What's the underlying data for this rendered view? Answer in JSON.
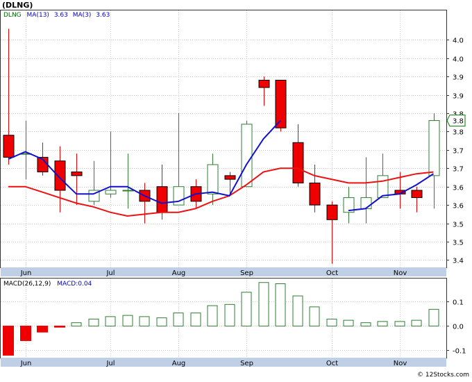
{
  "title": "(DLNG)",
  "footer": "© 12Stocks.com",
  "colors": {
    "up": "#2e7d32",
    "down": "#ee0000",
    "ma13": "#ee1111",
    "ma3": "#1111cc",
    "legend_ticker": "#006400",
    "legend_ma": "#0000cc",
    "macd": "#2e7d32",
    "last_price_box": "#007700"
  },
  "legend_top": {
    "ticker": "DLNG",
    "ma13": "MA(13)",
    "ma13_value": "3.63",
    "ma3": "MA(3)",
    "ma3_value": "3.63"
  },
  "legend_bottom": {
    "macd_params": "MACD(26,12,9)",
    "macd_value": "MACD:0.04"
  },
  "last_price_label": "3.8",
  "months": [
    {
      "label": "Jun",
      "week": 1
    },
    {
      "label": "Jul",
      "week": 6
    },
    {
      "label": "Aug",
      "week": 10
    },
    {
      "label": "Sep",
      "week": 14
    },
    {
      "label": "Oct",
      "week": 19
    },
    {
      "label": "Nov",
      "week": 23
    }
  ],
  "chart_data": [
    {
      "type": "candlestick",
      "ylim": [
        3.38,
        4.08
      ],
      "yticks": [
        3.4,
        3.45,
        3.5,
        3.55,
        3.6,
        3.65,
        3.7,
        3.75,
        3.8,
        3.85,
        3.9,
        3.95,
        4.0
      ],
      "ytick_labels": [
        "3.4",
        "3.5",
        "3.5",
        "3.6",
        "3.6",
        "3.7",
        "3.7",
        "3.8",
        "3.8",
        "3.9",
        "3.9",
        "4.0",
        "4.0"
      ],
      "grid": true,
      "candles": [
        {
          "o": 3.74,
          "h": 4.03,
          "l": 3.66,
          "c": 3.68
        },
        {
          "o": 3.69,
          "h": 3.78,
          "l": 3.62,
          "c": 3.69
        },
        {
          "o": 3.68,
          "h": 3.72,
          "l": 3.63,
          "c": 3.64
        },
        {
          "o": 3.67,
          "h": 3.71,
          "l": 3.53,
          "c": 3.59
        },
        {
          "o": 3.64,
          "h": 3.69,
          "l": 3.55,
          "c": 3.63
        },
        {
          "o": 3.56,
          "h": 3.67,
          "l": 3.55,
          "c": 3.59
        },
        {
          "o": 3.58,
          "h": 3.75,
          "l": 3.57,
          "c": 3.59
        },
        {
          "o": 3.59,
          "h": 3.69,
          "l": 3.54,
          "c": 3.59
        },
        {
          "o": 3.59,
          "h": 3.61,
          "l": 3.5,
          "c": 3.56
        },
        {
          "o": 3.6,
          "h": 3.66,
          "l": 3.51,
          "c": 3.53
        },
        {
          "o": 3.55,
          "h": 3.8,
          "l": 3.55,
          "c": 3.6
        },
        {
          "o": 3.6,
          "h": 3.62,
          "l": 3.54,
          "c": 3.56
        },
        {
          "o": 3.58,
          "h": 3.69,
          "l": 3.55,
          "c": 3.66
        },
        {
          "o": 3.63,
          "h": 3.64,
          "l": 3.58,
          "c": 3.62
        },
        {
          "o": 3.6,
          "h": 3.78,
          "l": 3.6,
          "c": 3.77
        },
        {
          "o": 3.89,
          "h": 3.9,
          "l": 3.82,
          "c": 3.87
        },
        {
          "o": 3.89,
          "h": 3.89,
          "l": 3.75,
          "c": 3.76
        },
        {
          "o": 3.72,
          "h": 3.77,
          "l": 3.6,
          "c": 3.61
        },
        {
          "o": 3.61,
          "h": 3.66,
          "l": 3.53,
          "c": 3.55
        },
        {
          "o": 3.55,
          "h": 3.56,
          "l": 3.39,
          "c": 3.51
        },
        {
          "o": 3.53,
          "h": 3.6,
          "l": 3.5,
          "c": 3.57
        },
        {
          "o": 3.54,
          "h": 3.68,
          "l": 3.5,
          "c": 3.57
        },
        {
          "o": 3.57,
          "h": 3.69,
          "l": 3.57,
          "c": 3.63
        },
        {
          "o": 3.59,
          "h": 3.64,
          "l": 3.54,
          "c": 3.58
        },
        {
          "o": 3.59,
          "h": 3.6,
          "l": 3.53,
          "c": 3.57
        },
        {
          "o": 3.63,
          "h": 3.8,
          "l": 3.54,
          "c": 3.78
        }
      ],
      "series": [
        {
          "name": "MA(13)",
          "values": [
            3.6,
            3.6,
            3.585,
            3.57,
            3.555,
            3.545,
            3.53,
            3.52,
            3.525,
            3.53,
            3.53,
            3.54,
            3.56,
            3.575,
            3.605,
            3.64,
            3.65,
            3.65,
            3.63,
            3.62,
            3.61,
            3.61,
            3.615,
            3.625,
            3.635,
            3.64
          ]
        },
        {
          "name": "MA(3)",
          "values": [
            3.675,
            3.695,
            3.675,
            3.625,
            3.58,
            3.58,
            3.6,
            3.6,
            3.575,
            3.555,
            3.56,
            3.58,
            3.585,
            3.575,
            3.66,
            3.73,
            3.78,
            null,
            null,
            null,
            3.535,
            3.54,
            3.575,
            3.58,
            3.605,
            3.635
          ]
        }
      ]
    },
    {
      "type": "bar",
      "name": "MACD(26,12,9)",
      "ylim": [
        -0.13,
        0.195
      ],
      "yticks": [
        -0.1,
        0.0,
        0.1
      ],
      "ytick_labels": [
        "-0.1",
        "0.0",
        "0.1"
      ],
      "grid": true,
      "values": [
        -0.12,
        -0.06,
        -0.025,
        -0.005,
        0.015,
        0.03,
        0.04,
        0.045,
        0.04,
        0.035,
        0.055,
        0.055,
        0.085,
        0.09,
        0.14,
        0.18,
        0.175,
        0.125,
        0.08,
        0.03,
        0.025,
        0.015,
        0.02,
        0.02,
        0.025,
        0.07
      ]
    }
  ]
}
